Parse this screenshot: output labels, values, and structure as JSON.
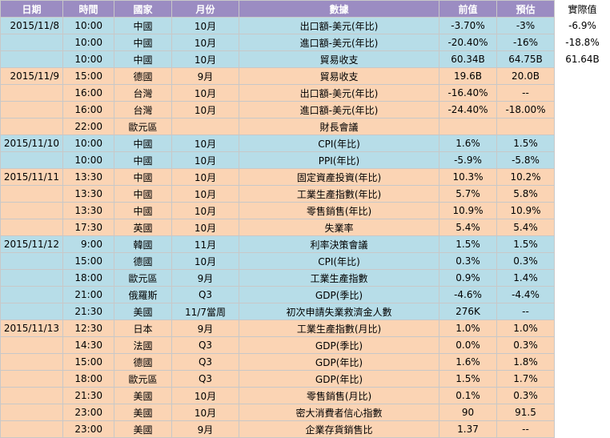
{
  "header": {
    "date": "日期",
    "time": "時間",
    "country": "國家",
    "month": "月份",
    "data": "數據",
    "previous": "前值",
    "forecast": "預估",
    "actual": "實際值"
  },
  "rows": [
    {
      "group": "blue",
      "date": "2015/11/8",
      "time": "10:00",
      "country": "中國",
      "month": "10月",
      "data": "出口額-美元(年比)",
      "previous": "-3.70%",
      "forecast": "-3%",
      "actual": "-6.9%"
    },
    {
      "group": "blue",
      "date": "",
      "time": "10:00",
      "country": "中國",
      "month": "10月",
      "data": "進口額-美元(年比)",
      "previous": "-20.40%",
      "forecast": "-16%",
      "actual": "-18.8%"
    },
    {
      "group": "blue",
      "date": "",
      "time": "10:00",
      "country": "中國",
      "month": "10月",
      "data": "貿易收支",
      "previous": "60.34B",
      "forecast": "64.75B",
      "actual": "61.64B"
    },
    {
      "group": "peach",
      "date": "2015/11/9",
      "time": "15:00",
      "country": "德國",
      "month": "9月",
      "data": "貿易收支",
      "previous": "19.6B",
      "forecast": "20.0B",
      "actual": ""
    },
    {
      "group": "peach",
      "date": "",
      "time": "16:00",
      "country": "台灣",
      "month": "10月",
      "data": "出口額-美元(年比)",
      "previous": "-16.40%",
      "forecast": "--",
      "actual": ""
    },
    {
      "group": "peach",
      "date": "",
      "time": "16:00",
      "country": "台灣",
      "month": "10月",
      "data": "進口額-美元(年比)",
      "previous": "-24.40%",
      "forecast": "-18.00%",
      "actual": ""
    },
    {
      "group": "peach",
      "date": "",
      "time": "22:00",
      "country": "歐元區",
      "month": "",
      "data": "財長會議",
      "previous": "",
      "forecast": "",
      "actual": ""
    },
    {
      "group": "blue",
      "date": "2015/11/10",
      "time": "10:00",
      "country": "中國",
      "month": "10月",
      "data": "CPI(年比)",
      "previous": "1.6%",
      "forecast": "1.5%",
      "actual": ""
    },
    {
      "group": "blue",
      "date": "",
      "time": "10:00",
      "country": "中國",
      "month": "10月",
      "data": "PPI(年比)",
      "previous": "-5.9%",
      "forecast": "-5.8%",
      "actual": ""
    },
    {
      "group": "peach",
      "date": "2015/11/11",
      "time": "13:30",
      "country": "中國",
      "month": "10月",
      "data": "固定資產投資(年比)",
      "previous": "10.3%",
      "forecast": "10.2%",
      "actual": ""
    },
    {
      "group": "peach",
      "date": "",
      "time": "13:30",
      "country": "中國",
      "month": "10月",
      "data": "工業生產指數(年比)",
      "previous": "5.7%",
      "forecast": "5.8%",
      "actual": ""
    },
    {
      "group": "peach",
      "date": "",
      "time": "13:30",
      "country": "中國",
      "month": "10月",
      "data": "零售銷售(年比)",
      "previous": "10.9%",
      "forecast": "10.9%",
      "actual": ""
    },
    {
      "group": "peach",
      "date": "",
      "time": "17:30",
      "country": "英國",
      "month": "10月",
      "data": "失業率",
      "previous": "5.4%",
      "forecast": "5.4%",
      "actual": ""
    },
    {
      "group": "blue",
      "date": "2015/11/12",
      "time": "9:00",
      "country": "韓國",
      "month": "11月",
      "data": "利率決策會議",
      "previous": "1.5%",
      "forecast": "1.5%",
      "actual": ""
    },
    {
      "group": "blue",
      "date": "",
      "time": "15:00",
      "country": "德國",
      "month": "10月",
      "data": "CPI(年比)",
      "previous": "0.3%",
      "forecast": "0.3%",
      "actual": ""
    },
    {
      "group": "blue",
      "date": "",
      "time": "18:00",
      "country": "歐元區",
      "month": "9月",
      "data": "工業生產指數",
      "previous": "0.9%",
      "forecast": "1.4%",
      "actual": ""
    },
    {
      "group": "blue",
      "date": "",
      "time": "21:00",
      "country": "俄羅斯",
      "month": "Q3",
      "data": "GDP(季比)",
      "previous": "-4.6%",
      "forecast": "-4.4%",
      "actual": ""
    },
    {
      "group": "blue",
      "date": "",
      "time": "21:30",
      "country": "美國",
      "month": "11/7當周",
      "data": "初次申請失業救濟金人數",
      "previous": "276K",
      "forecast": "--",
      "actual": ""
    },
    {
      "group": "peach",
      "date": "2015/11/13",
      "time": "12:30",
      "country": "日本",
      "month": "9月",
      "data": "工業生產指數(月比)",
      "previous": "1.0%",
      "forecast": "1.0%",
      "actual": ""
    },
    {
      "group": "peach",
      "date": "",
      "time": "14:30",
      "country": "法國",
      "month": "Q3",
      "data": "GDP(季比)",
      "previous": "0.0%",
      "forecast": "0.3%",
      "actual": ""
    },
    {
      "group": "peach",
      "date": "",
      "time": "15:00",
      "country": "德國",
      "month": "Q3",
      "data": "GDP(年比)",
      "previous": "1.6%",
      "forecast": "1.8%",
      "actual": ""
    },
    {
      "group": "peach",
      "date": "",
      "time": "18:00",
      "country": "歐元區",
      "month": "Q3",
      "data": "GDP(年比)",
      "previous": "1.5%",
      "forecast": "1.7%",
      "actual": ""
    },
    {
      "group": "peach",
      "date": "",
      "time": "21:30",
      "country": "美國",
      "month": "10月",
      "data": "零售銷售(月比)",
      "previous": "0.1%",
      "forecast": "0.3%",
      "actual": ""
    },
    {
      "group": "peach",
      "date": "",
      "time": "23:00",
      "country": "美國",
      "month": "10月",
      "data": "密大消費者信心指數",
      "previous": "90",
      "forecast": "91.5",
      "actual": ""
    },
    {
      "group": "peach",
      "date": "",
      "time": "23:00",
      "country": "美國",
      "month": "9月",
      "data": "企業存貨銷售比",
      "previous": "1.37",
      "forecast": "--",
      "actual": ""
    }
  ],
  "colors": {
    "header_bg": "#9b8cc2",
    "group_blue": "#b7dde8",
    "group_peach": "#fbd4b4"
  }
}
